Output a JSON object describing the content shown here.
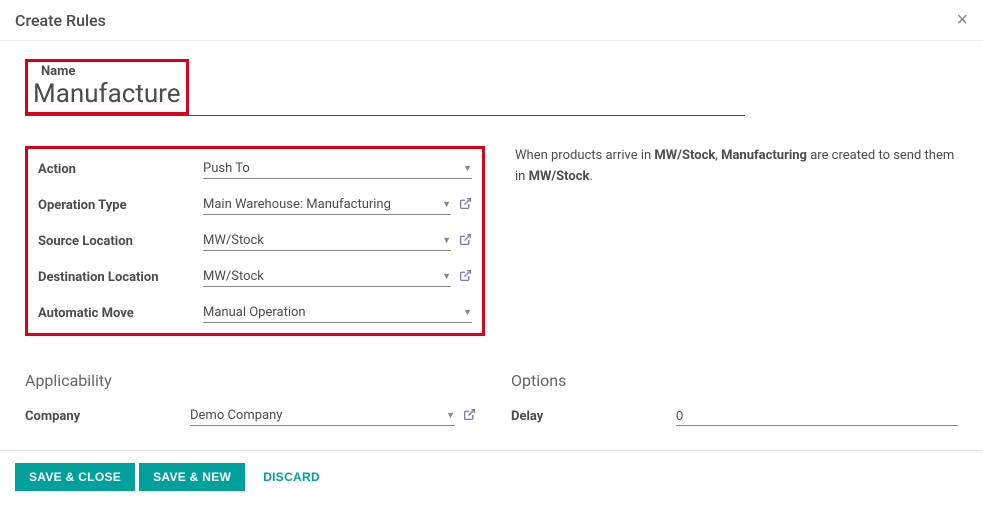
{
  "modal": {
    "title": "Create Rules",
    "close_icon": "×"
  },
  "name": {
    "label": "Name",
    "value": "Manufacture"
  },
  "form": {
    "action": {
      "label": "Action",
      "value": "Push To"
    },
    "operation_type": {
      "label": "Operation Type",
      "value": "Main Warehouse: Manufacturing"
    },
    "source_location": {
      "label": "Source Location",
      "value": "MW/Stock"
    },
    "destination_location": {
      "label": "Destination Location",
      "value": "MW/Stock"
    },
    "automatic_move": {
      "label": "Automatic Move",
      "value": "Manual Operation"
    }
  },
  "info": {
    "part1": "When products arrive in ",
    "bold1": "MW/Stock",
    "part2": ", ",
    "bold2": "Manufacturing",
    "part3": " are created to send them in ",
    "bold3": "MW/Stock",
    "part4": "."
  },
  "applicability": {
    "heading": "Applicability",
    "company_label": "Company",
    "company_value": "Demo Company"
  },
  "options": {
    "heading": "Options",
    "delay_label": "Delay",
    "delay_value": "0"
  },
  "footer": {
    "save_close": "SAVE & CLOSE",
    "save_new": "SAVE & NEW",
    "discard": "DISCARD"
  }
}
